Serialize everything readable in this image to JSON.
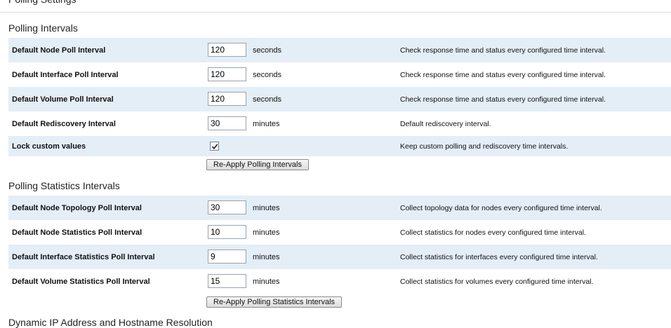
{
  "polling": {
    "title": "Polling Intervals",
    "rows": [
      {
        "label": "Default Node Poll Interval",
        "value": "120",
        "unit": "seconds",
        "desc": "Check response time and status every configured time interval."
      },
      {
        "label": "Default Interface Poll Interval",
        "value": "120",
        "unit": "seconds",
        "desc": "Check response time and status every configured time interval."
      },
      {
        "label": "Default Volume Poll Interval",
        "value": "120",
        "unit": "seconds",
        "desc": "Check response time and status every configured time interval."
      },
      {
        "label": "Default Rediscovery Interval",
        "value": "30",
        "unit": "minutes",
        "desc": "Default rediscovery interval."
      }
    ],
    "lock": {
      "label": "Lock custom values",
      "checked": true,
      "desc": "Keep custom polling and rediscovery time intervals."
    },
    "reapply_label": "Re-Apply Polling Intervals"
  },
  "statistics": {
    "title": "Polling Statistics Intervals",
    "rows": [
      {
        "label": "Default Node Topology Poll Interval",
        "value": "30",
        "unit": "minutes",
        "desc": "Collect topology data for nodes every configured time interval."
      },
      {
        "label": "Default Node Statistics Poll Interval",
        "value": "10",
        "unit": "minutes",
        "desc": "Collect statistics for nodes every configured time interval."
      },
      {
        "label": "Default Interface Statistics Poll Interval",
        "value": "9",
        "unit": "minutes",
        "desc": "Collect statistics for interfaces every configured time interval."
      },
      {
        "label": "Default Volume Statistics Poll Interval",
        "value": "15",
        "unit": "minutes",
        "desc": "Collect statistics for volumes every configured time interval."
      }
    ],
    "reapply_label": "Re-Apply Polling Statistics Intervals"
  },
  "next_section": {
    "title": "Dynamic IP Address and Hostname Resolution"
  }
}
